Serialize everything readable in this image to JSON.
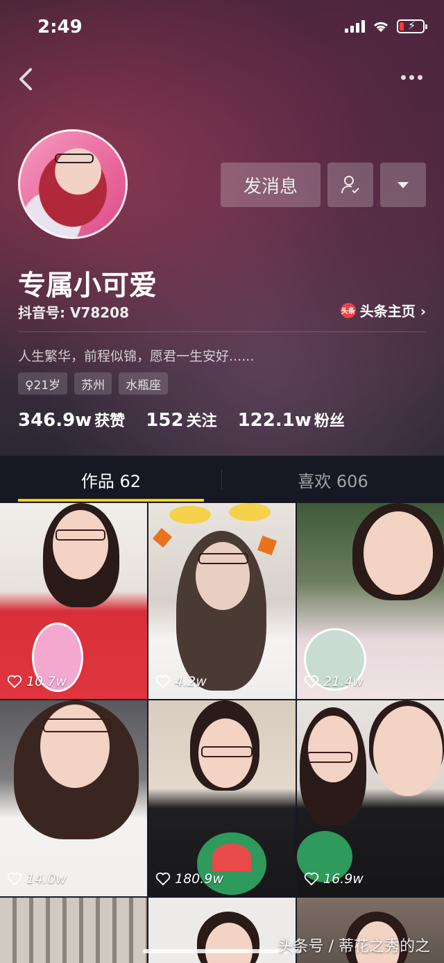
{
  "status_bar": {
    "time": "2:49"
  },
  "profile": {
    "name": "专属小可爱",
    "douyin_id": "抖音号: V78208",
    "toutiao_icon": "头条",
    "toutiao_link": "头条主页 ›",
    "bio": "人生繁华，前程似锦，愿君一生安好......",
    "tags": [
      "♀21岁",
      "苏州",
      "水瓶座"
    ]
  },
  "actions": {
    "message": "发消息"
  },
  "stats": {
    "likes_num": "346.9w",
    "likes_label": "获赞",
    "following_num": "152",
    "following_label": "关注",
    "fans_num": "122.1w",
    "fans_label": "粉丝"
  },
  "tabs": {
    "works": "作品 62",
    "likes": "喜欢 606"
  },
  "videos": [
    {
      "likes": "10.7w"
    },
    {
      "likes": "4.2w"
    },
    {
      "likes": "21.4w"
    },
    {
      "likes": "14.0w"
    },
    {
      "likes": "180.9w"
    },
    {
      "likes": "16.9w"
    }
  ],
  "watermark": "头条号 / 蒂花之秀的之",
  "colors": {
    "accent": "#face15",
    "background": "#161823"
  }
}
